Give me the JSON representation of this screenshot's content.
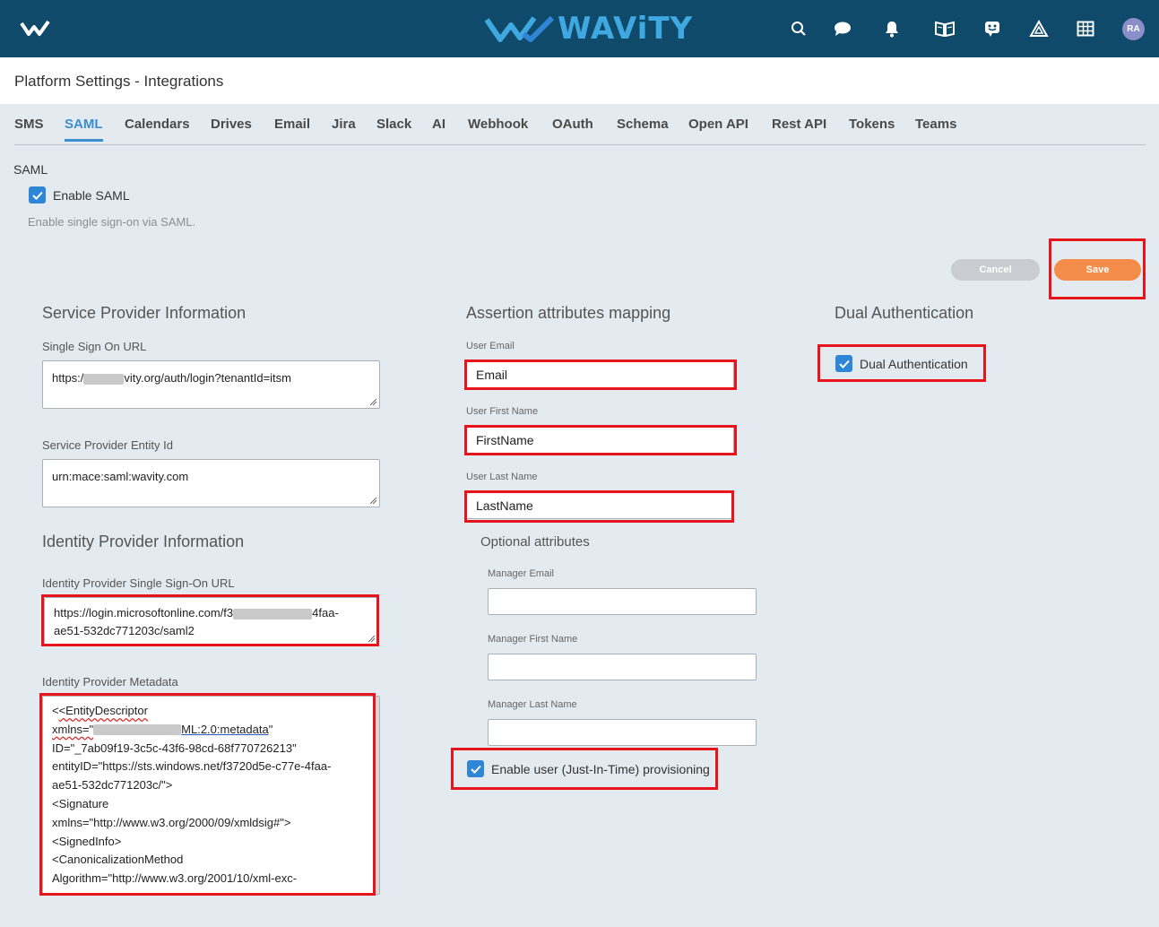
{
  "brand": {
    "name": "WAViTY"
  },
  "user": {
    "initials": "RA"
  },
  "page": {
    "title": "Platform Settings - Integrations"
  },
  "tabs": [
    "SMS",
    "SAML",
    "Calendars",
    "Drives",
    "Email",
    "Jira",
    "Slack",
    "AI",
    "Webhook",
    "OAuth",
    "Schema",
    "Open API",
    "Rest API",
    "Tokens",
    "Teams"
  ],
  "active_tab": "SAML",
  "saml": {
    "section_label": "SAML",
    "enable_label": "Enable SAML",
    "enable_checked": true,
    "enable_hint": "Enable single sign-on via SAML."
  },
  "actions": {
    "cancel_label": "Cancel",
    "save_label": "Save"
  },
  "service_provider": {
    "heading": "Service Provider Information",
    "sso_url_label": "Single Sign On URL",
    "sso_url_prefix": "https:/",
    "sso_url_suffix": "vity.org/auth/login?tenantId=itsm",
    "entity_id_label": "Service Provider Entity Id",
    "entity_id_value": "urn:mace:saml:wavity.com"
  },
  "identity_provider": {
    "heading": "Identity Provider Information",
    "sso_url_label": "Identity Provider Single Sign-On URL",
    "sso_url_line1_prefix": "https://login.microsoftonline.com/f3",
    "sso_url_line1_suffix": "4faa-",
    "sso_url_line2": "ae51-532dc771203c/saml2",
    "metadata_label": "Identity Provider Metadata",
    "metadata_lines": [
      "<EntityDescriptor",
      "ID=\"_7ab09f19-3c5c-43f6-98cd-68f770726213\"",
      "entityID=\"https://sts.windows.net/f3720d5e-c77e-4faa-",
      "ae51-532dc771203c/\">",
      "<Signature",
      "xmlns=\"http://www.w3.org/2000/09/xmldsig#\">",
      "<SignedInfo>",
      "<CanonicalizationMethod",
      "Algorithm=\"http://www.w3.org/2001/10/xml-exc-"
    ],
    "metadata_xmlns_prefix": "xmlns=\"",
    "metadata_xmlns_suffix_a": "ML:2.0:metadata",
    "metadata_xmlns_suffix_b": "\""
  },
  "assertion": {
    "heading": "Assertion attributes mapping",
    "email_label": "User Email",
    "email_value": "Email",
    "first_label": "User First Name",
    "first_value": "FirstName",
    "last_label": "User Last Name",
    "last_value": "LastName"
  },
  "optional": {
    "heading": "Optional attributes",
    "manager_email_label": "Manager Email",
    "manager_email_value": "",
    "manager_first_label": "Manager First Name",
    "manager_first_value": "",
    "manager_last_label": "Manager Last Name",
    "manager_last_value": "",
    "jit_label": "Enable user (Just-In-Time) provisioning",
    "jit_checked": true
  },
  "dual_auth": {
    "heading": "Dual Authentication",
    "label": "Dual Authentication",
    "checked": true
  },
  "icons": [
    "wavity-mark-icon",
    "search-icon",
    "chat-icon",
    "bell-icon",
    "book-icon",
    "assistant-icon",
    "triangle-icon",
    "grid-icon"
  ],
  "colors": {
    "topbar": "#0f4a6b",
    "accent": "#3a8ed0",
    "save": "#f58d4a",
    "highlight": "#e8141b"
  }
}
